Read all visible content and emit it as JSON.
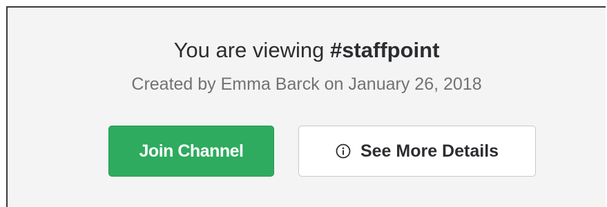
{
  "intro": {
    "prefix": "You are viewing",
    "channel_name": "#staffpoint",
    "created_line": "Created by Emma Barck on January 26, 2018"
  },
  "actions": {
    "join_label": "Join Channel",
    "details_label": "See More Details",
    "details_icon": "info-circle-icon"
  },
  "colors": {
    "join_button": "#2eab5e",
    "text_primary": "#2c2d30",
    "text_secondary": "#717274",
    "panel_background": "#f4f4f4"
  }
}
